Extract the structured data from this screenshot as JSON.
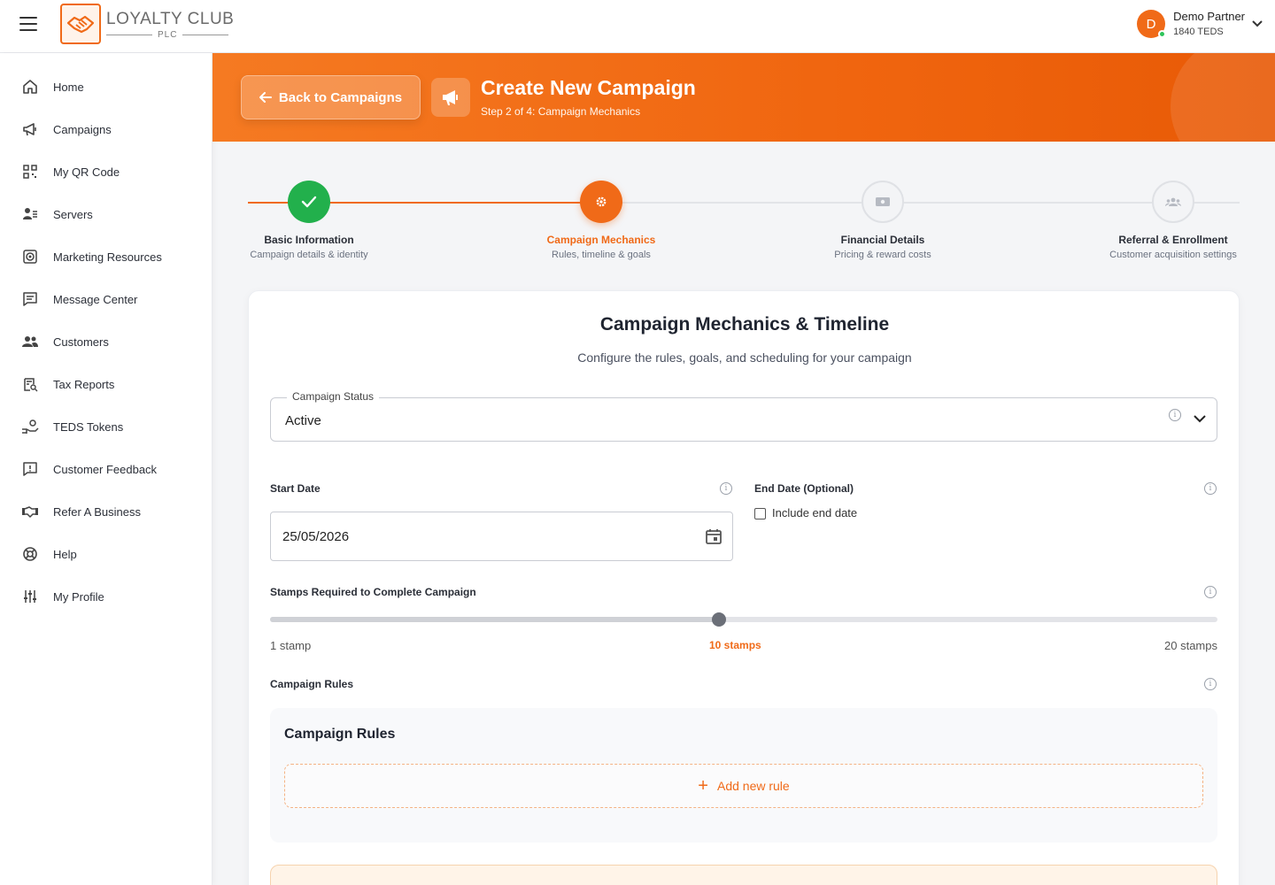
{
  "brand": {
    "title": "LOYALTY CLUB",
    "sub": "PLC"
  },
  "user": {
    "initial": "D",
    "name": "Demo Partner",
    "teds": "1840 TEDS"
  },
  "sidebar": {
    "items": [
      {
        "label": "Home",
        "icon": "home-icon"
      },
      {
        "label": "Campaigns",
        "icon": "megaphone-icon"
      },
      {
        "label": "My QR Code",
        "icon": "qr-code-icon"
      },
      {
        "label": "Servers",
        "icon": "servers-icon"
      },
      {
        "label": "Marketing Resources",
        "icon": "target-icon"
      },
      {
        "label": "Message Center",
        "icon": "message-icon"
      },
      {
        "label": "Customers",
        "icon": "customers-icon"
      },
      {
        "label": "Tax Reports",
        "icon": "tax-report-icon"
      },
      {
        "label": "TEDS Tokens",
        "icon": "tokens-icon"
      },
      {
        "label": "Customer Feedback",
        "icon": "feedback-icon"
      },
      {
        "label": "Refer A Business",
        "icon": "handshake-icon"
      },
      {
        "label": "Help",
        "icon": "lifebuoy-icon"
      },
      {
        "label": "My Profile",
        "icon": "sliders-icon"
      }
    ]
  },
  "header": {
    "back_label": "Back to Campaigns",
    "title": "Create New Campaign",
    "subtitle": "Step 2 of 4: Campaign Mechanics",
    "accent": "#f06a18"
  },
  "steps": [
    {
      "title": "Basic Information",
      "sub": "Campaign details & identity",
      "state": "done"
    },
    {
      "title": "Campaign Mechanics",
      "sub": "Rules, timeline & goals",
      "state": "active"
    },
    {
      "title": "Financial Details",
      "sub": "Pricing & reward costs",
      "state": "pending"
    },
    {
      "title": "Referral & Enrollment",
      "sub": "Customer acquisition settings",
      "state": "pending"
    }
  ],
  "form": {
    "title": "Campaign Mechanics & Timeline",
    "subtitle": "Configure the rules, goals, and scheduling for your campaign",
    "status_label": "Campaign Status",
    "status_value": "Active",
    "start_label": "Start Date",
    "start_value": "25/05/2026",
    "end_label": "End Date (Optional)",
    "end_checkbox_label": "Include end date",
    "end_checked": false,
    "stamps_label": "Stamps Required to Complete Campaign",
    "stamps_min_label": "1 stamp",
    "stamps_current_label": "10 stamps",
    "stamps_max_label": "20 stamps",
    "stamps_min": 1,
    "stamps_max": 20,
    "stamps_value": 10,
    "rules_label": "Campaign Rules",
    "rules_box_title": "Campaign Rules",
    "add_rule_label": "Add new rule"
  }
}
